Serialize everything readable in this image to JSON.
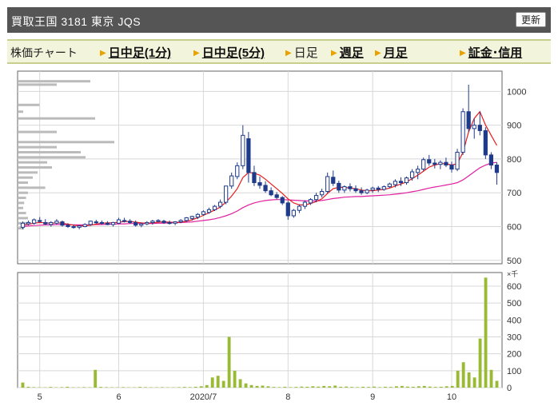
{
  "header": {
    "title": "買取王国  3181  東京 JQS",
    "update_label": "更新"
  },
  "nav": {
    "label": "株価チャート",
    "items": [
      {
        "label": "日中足(1分)",
        "active": false
      },
      {
        "label": "日中足(5分)",
        "active": false
      },
      {
        "label": "日足",
        "active": true
      },
      {
        "label": "週足",
        "active": false
      },
      {
        "label": "月足",
        "active": false
      },
      {
        "label": "証金･信用",
        "active": false
      }
    ]
  },
  "chart_data": [
    {
      "type": "candlestick",
      "y_ticks": [
        500,
        600,
        700,
        800,
        900,
        1000
      ],
      "ylim": [
        490,
        1060
      ],
      "x_labels": [
        "5",
        "6",
        "2020/7",
        "8",
        "9",
        "10"
      ],
      "grid": true,
      "colors": {
        "up": "#ffffff",
        "down": "#1f3a8a",
        "ma_short": "#e81c1c",
        "ma_long": "#e0209f",
        "volume_profile": "#bbbbbb"
      },
      "candles": [
        [
          598,
          615,
          592,
          610
        ],
        [
          608,
          618,
          604,
          612
        ],
        [
          610,
          624,
          606,
          620
        ],
        [
          618,
          628,
          612,
          615
        ],
        [
          612,
          622,
          604,
          608
        ],
        [
          606,
          616,
          600,
          612
        ],
        [
          610,
          622,
          606,
          616
        ],
        [
          614,
          618,
          600,
          604
        ],
        [
          604,
          610,
          596,
          600
        ],
        [
          600,
          606,
          594,
          598
        ],
        [
          598,
          604,
          592,
          602
        ],
        [
          600,
          610,
          598,
          606
        ],
        [
          606,
          618,
          602,
          616
        ],
        [
          614,
          620,
          608,
          612
        ],
        [
          612,
          618,
          606,
          610
        ],
        [
          610,
          616,
          604,
          606
        ],
        [
          606,
          614,
          600,
          612
        ],
        [
          610,
          626,
          608,
          620
        ],
        [
          618,
          626,
          612,
          616
        ],
        [
          616,
          622,
          608,
          612
        ],
        [
          612,
          618,
          600,
          604
        ],
        [
          604,
          612,
          598,
          608
        ],
        [
          608,
          616,
          604,
          612
        ],
        [
          612,
          620,
          606,
          616
        ],
        [
          616,
          622,
          612,
          618
        ],
        [
          616,
          620,
          608,
          612
        ],
        [
          612,
          618,
          606,
          610
        ],
        [
          610,
          616,
          604,
          614
        ],
        [
          614,
          622,
          610,
          618
        ],
        [
          618,
          628,
          614,
          626
        ],
        [
          624,
          632,
          618,
          630
        ],
        [
          628,
          640,
          622,
          636
        ],
        [
          636,
          648,
          632,
          644
        ],
        [
          642,
          656,
          638,
          650
        ],
        [
          650,
          664,
          646,
          660
        ],
        [
          660,
          680,
          654,
          672
        ],
        [
          672,
          700,
          666,
          720
        ],
        [
          720,
          760,
          712,
          750
        ],
        [
          748,
          790,
          740,
          780
        ],
        [
          780,
          900,
          770,
          870
        ],
        [
          860,
          880,
          730,
          760
        ],
        [
          760,
          780,
          720,
          730
        ],
        [
          730,
          748,
          712,
          722
        ],
        [
          722,
          734,
          700,
          706
        ],
        [
          706,
          716,
          690,
          694
        ],
        [
          694,
          702,
          680,
          686
        ],
        [
          686,
          690,
          664,
          670
        ],
        [
          670,
          676,
          620,
          632
        ],
        [
          632,
          652,
          626,
          648
        ],
        [
          648,
          666,
          640,
          660
        ],
        [
          660,
          678,
          652,
          672
        ],
        [
          670,
          684,
          664,
          680
        ],
        [
          680,
          700,
          672,
          692
        ],
        [
          694,
          712,
          686,
          704
        ],
        [
          704,
          760,
          698,
          748
        ],
        [
          746,
          766,
          720,
          728
        ],
        [
          728,
          736,
          700,
          708
        ],
        [
          708,
          722,
          700,
          718
        ],
        [
          718,
          728,
          704,
          712
        ],
        [
          712,
          722,
          700,
          706
        ],
        [
          706,
          716,
          694,
          700
        ],
        [
          700,
          712,
          696,
          708
        ],
        [
          708,
          718,
          700,
          714
        ],
        [
          714,
          720,
          702,
          710
        ],
        [
          710,
          722,
          706,
          718
        ],
        [
          718,
          730,
          714,
          726
        ],
        [
          724,
          740,
          716,
          734
        ],
        [
          734,
          746,
          720,
          730
        ],
        [
          730,
          748,
          724,
          744
        ],
        [
          744,
          770,
          736,
          762
        ],
        [
          760,
          780,
          740,
          770
        ],
        [
          770,
          804,
          764,
          798
        ],
        [
          798,
          812,
          780,
          788
        ],
        [
          788,
          800,
          772,
          784
        ],
        [
          784,
          796,
          770,
          790
        ],
        [
          790,
          804,
          776,
          782
        ],
        [
          782,
          792,
          760,
          770
        ],
        [
          770,
          830,
          764,
          820
        ],
        [
          820,
          950,
          812,
          940
        ],
        [
          940,
          1020,
          880,
          890
        ],
        [
          890,
          920,
          860,
          900
        ],
        [
          900,
          940,
          870,
          884
        ],
        [
          884,
          894,
          800,
          812
        ],
        [
          812,
          820,
          770,
          782
        ],
        [
          782,
          790,
          724,
          760
        ]
      ],
      "ma_short": [
        604,
        607,
        610,
        612,
        611,
        610,
        611,
        610,
        607,
        604,
        602,
        602,
        604,
        607,
        610,
        611,
        611,
        613,
        615,
        615,
        613,
        611,
        610,
        611,
        613,
        614,
        613,
        612,
        613,
        616,
        620,
        626,
        633,
        641,
        649,
        658,
        672,
        690,
        712,
        745,
        760,
        758,
        752,
        740,
        726,
        712,
        698,
        682,
        670,
        664,
        664,
        668,
        674,
        682,
        698,
        712,
        716,
        716,
        714,
        712,
        708,
        706,
        706,
        708,
        710,
        714,
        720,
        726,
        732,
        742,
        752,
        764,
        776,
        782,
        786,
        786,
        782,
        786,
        820,
        880,
        920,
        940,
        900,
        870,
        840
      ],
      "ma_long": [
        600,
        602,
        603,
        604,
        605,
        605,
        606,
        606,
        606,
        605,
        605,
        605,
        605,
        606,
        606,
        607,
        607,
        608,
        608,
        609,
        609,
        609,
        609,
        609,
        610,
        610,
        611,
        611,
        612,
        613,
        614,
        616,
        618,
        620,
        623,
        627,
        632,
        638,
        646,
        656,
        664,
        670,
        674,
        677,
        679,
        680,
        680,
        679,
        678,
        677,
        676,
        676,
        676,
        677,
        680,
        683,
        685,
        687,
        688,
        689,
        689,
        690,
        691,
        692,
        693,
        694,
        696,
        698,
        700,
        703,
        706,
        710,
        714,
        717,
        720,
        723,
        726,
        730,
        738,
        750,
        762,
        774,
        782,
        788,
        790
      ],
      "volume_profile": [
        [
          1030,
          0.75
        ],
        [
          1020,
          0.4
        ],
        [
          960,
          0.22
        ],
        [
          940,
          0.05
        ],
        [
          920,
          0.8
        ],
        [
          880,
          0.4
        ],
        [
          850,
          1.0
        ],
        [
          835,
          0.4
        ],
        [
          820,
          0.65
        ],
        [
          805,
          0.7
        ],
        [
          790,
          0.3
        ],
        [
          775,
          0.35
        ],
        [
          760,
          0.2
        ],
        [
          745,
          0.15
        ],
        [
          730,
          0.1
        ],
        [
          715,
          0.28
        ],
        [
          700,
          0.1
        ],
        [
          685,
          0.08
        ],
        [
          670,
          0.06
        ],
        [
          655,
          0.05
        ],
        [
          640,
          0.08
        ],
        [
          625,
          0.1
        ],
        [
          610,
          0.12
        ],
        [
          595,
          0.06
        ]
      ]
    },
    {
      "type": "bar",
      "unit": "×千",
      "y_ticks": [
        0,
        100,
        200,
        300,
        400,
        500,
        600
      ],
      "ylim": [
        0,
        680
      ],
      "color": "#99bb33",
      "volumes": [
        30,
        5,
        3,
        2,
        2,
        4,
        2,
        3,
        5,
        2,
        2,
        3,
        2,
        105,
        4,
        3,
        2,
        2,
        3,
        2,
        2,
        4,
        3,
        2,
        2,
        3,
        2,
        2,
        3,
        4,
        3,
        5,
        8,
        15,
        60,
        70,
        40,
        300,
        100,
        50,
        25,
        15,
        10,
        12,
        8,
        4,
        3,
        5,
        3,
        4,
        6,
        5,
        8,
        6,
        10,
        8,
        12,
        5,
        6,
        4,
        3,
        5,
        4,
        6,
        3,
        5,
        4,
        8,
        10,
        6,
        5,
        8,
        10,
        6,
        4,
        5,
        8,
        10,
        100,
        150,
        90,
        60,
        290,
        650,
        105,
        40
      ]
    }
  ]
}
